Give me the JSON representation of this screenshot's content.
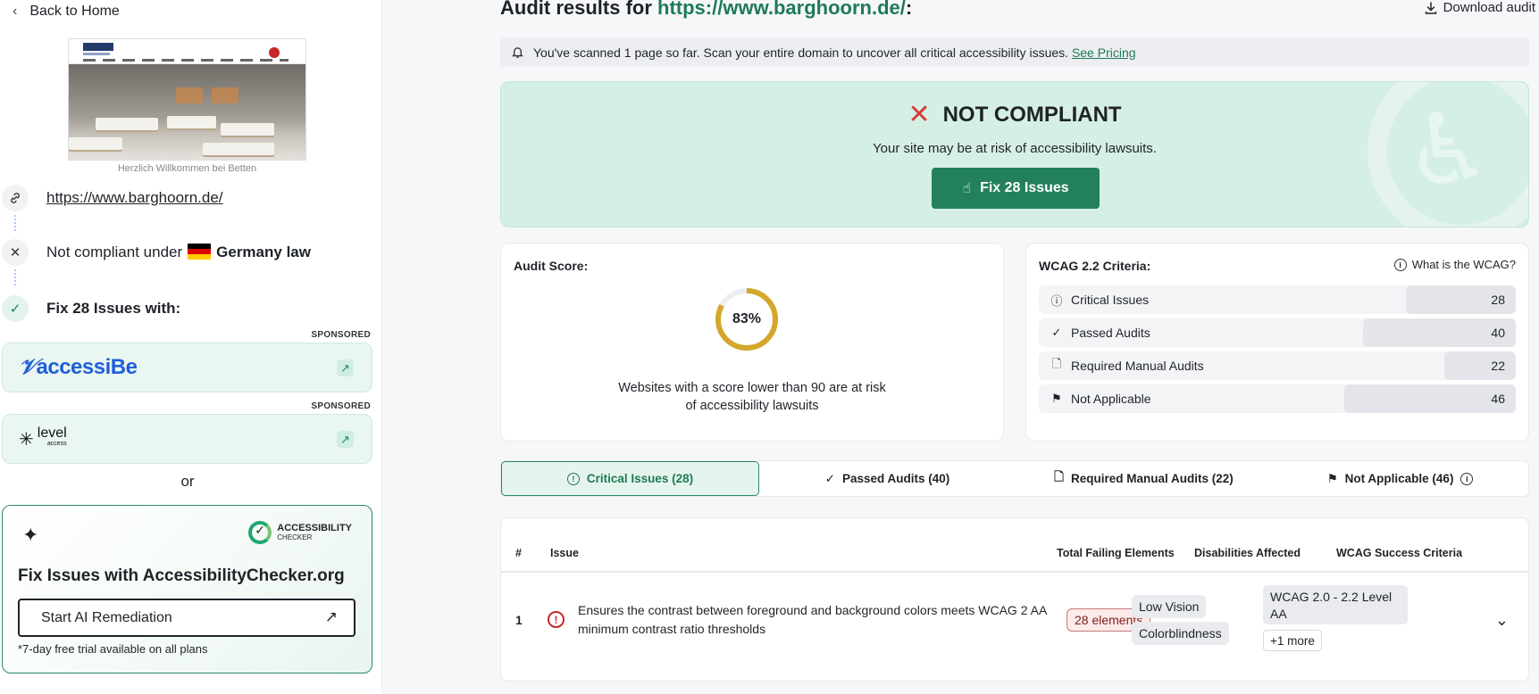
{
  "sidebar": {
    "back_label": "Back to Home",
    "thumb_caption": "Herzlich Willkommen bei Betten",
    "site_url": "https://www.barghoorn.de/",
    "compliance_prefix": "Not compliant under",
    "compliance_law": "Germany law",
    "fix_with": "Fix 28 Issues with:",
    "sponsored_label": "SPONSORED",
    "sponsor1_name": "accessiBe",
    "sponsor2_name": "level",
    "sponsor2_sub": "access",
    "or_label": "or",
    "ac_logo_title": "ACCESSIBILITY",
    "ac_logo_sub": "CHECKER",
    "ac_title": "Fix Issues with AccessibilityChecker.org",
    "ac_button": "Start AI Remediation",
    "ac_note": "*7-day free trial available on all plans"
  },
  "header": {
    "title_prefix": "Audit results for",
    "title_url": "https://www.barghoorn.de/",
    "title_suffix": ":",
    "download_label": "Download audit"
  },
  "banner": {
    "text": "You've scanned 1 page so far. Scan your entire domain to uncover all critical accessibility issues.",
    "link": "See Pricing"
  },
  "status": {
    "label": "NOT COMPLIANT",
    "sub": "Your site may be at risk of accessibility lawsuits.",
    "button": "Fix 28 Issues"
  },
  "score": {
    "title": "Audit Score:",
    "value": 83,
    "display": "83%",
    "note_line1": "Websites with a score lower than 90 are at risk",
    "note_line2": "of accessibility lawsuits",
    "ring_color": "#d4a72c"
  },
  "wcag": {
    "title": "WCAG 2.2 Criteria:",
    "help": "What is the WCAG?",
    "rows": [
      {
        "label": "Critical Issues",
        "count": "28",
        "fill": 0.23
      },
      {
        "label": "Passed Audits",
        "count": "40",
        "fill": 0.32
      },
      {
        "label": "Required Manual Audits",
        "count": "22",
        "fill": 0.15
      },
      {
        "label": "Not Applicable",
        "count": "46",
        "fill": 0.36
      }
    ]
  },
  "tabs": [
    {
      "label": "Critical Issues (28)"
    },
    {
      "label": "Passed Audits (40)"
    },
    {
      "label": "Required Manual Audits (22)"
    },
    {
      "label": "Not Applicable (46)"
    }
  ],
  "table": {
    "headers": [
      "#",
      "Issue",
      "Total Failing Elements",
      "Disabilities Affected",
      "WCAG Success Criteria"
    ],
    "rows": [
      {
        "num": "1",
        "issue": "Ensures the contrast between foreground and background colors meets WCAG 2 AA minimum contrast ratio thresholds",
        "failing": "28 elements",
        "disabilities": [
          "Low Vision",
          "Colorblindness"
        ],
        "criteria": "WCAG 2.0 - 2.2 Level AA",
        "more": "+1 more"
      }
    ]
  },
  "colors": {
    "accent": "#23805c",
    "danger": "#d63c3c",
    "status_bg": "#d6efe4"
  }
}
